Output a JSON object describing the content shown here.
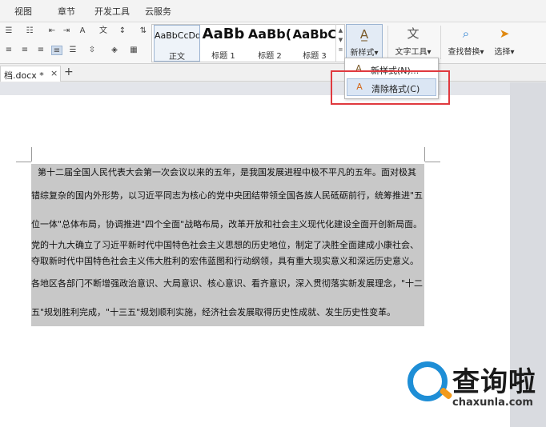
{
  "menu": [
    "视图",
    "章节",
    "开发工具",
    "云服务"
  ],
  "styles": [
    {
      "sample": "AaBbCcDd",
      "name": "正文"
    },
    {
      "sample": "AaBb",
      "name": "标题 1"
    },
    {
      "sample": "AaBb(",
      "name": "标题 2"
    },
    {
      "sample": "AaBbC",
      "name": "标题 3"
    }
  ],
  "ribbon": {
    "new_style": "新样式",
    "text_tools": "文字工具",
    "find_replace": "查找替换",
    "select": "选择"
  },
  "tab": {
    "name": "档.docx *",
    "close": "×",
    "add": "+"
  },
  "dropdown": {
    "new_style": "新样式(N)...",
    "clear_format": "清除格式(C)"
  },
  "document": {
    "lines": [
      "第十二届全国人民代表大会第一次会议以来的五年，是我国发展进程中极不平凡的五年。面对极其",
      "错综复杂的国内外形势，以习近平同志为核心的党中央团结带领全国各族人民砥砺前行，统筹推进\"五",
      "位一体\"总体布局，协调推进\"四个全面\"战略布局，改革开放和社会主义现代化建设全面开创新局面。",
      "党的十九大确立了习近平新时代中国特色社会主义思想的历史地位，制定了决胜全面建成小康社会、",
      "夺取新时代中国特色社会主义伟大胜利的宏伟蓝图和行动纲领，具有重大现实意义和深远历史意义。",
      "各地区各部门不断增强政治意识、大局意识、核心意识、看齐意识，深入贯彻落实新发展理念，\"十二",
      "五\"规划胜利完成，\"十三五\"规划顺利实施，经济社会发展取得历史性成就、发生历史性变革。"
    ]
  },
  "watermark": {
    "cn": "查询啦",
    "url": "chaxunla.com"
  },
  "colors": {
    "highlight": "#e0393e",
    "selection": "#c8c8c8",
    "accent": "#1e8ed6"
  }
}
